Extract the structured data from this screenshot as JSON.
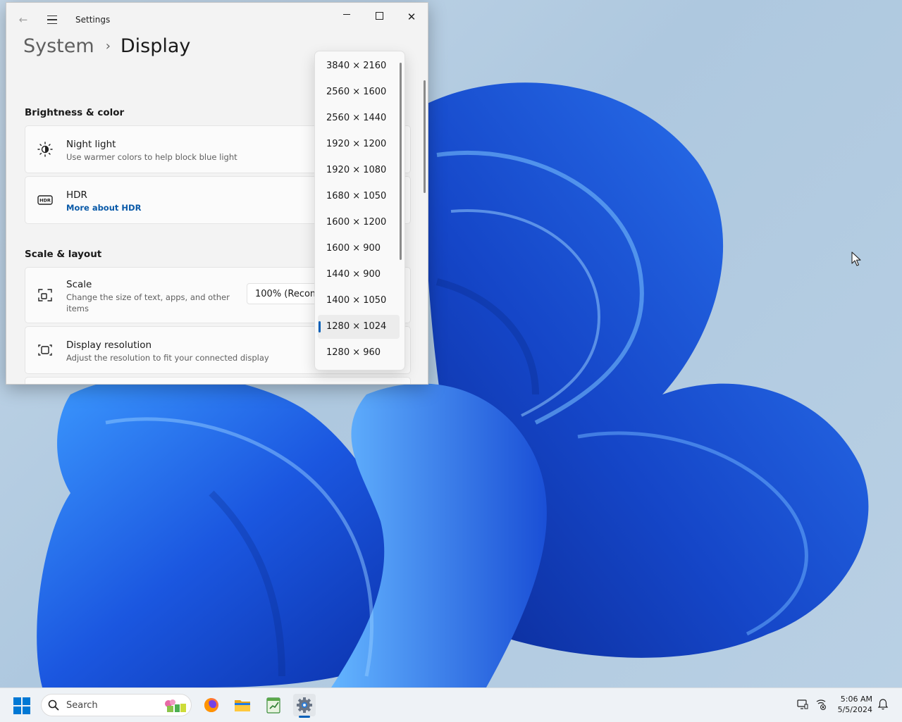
{
  "window": {
    "app_title": "Settings",
    "breadcrumb": {
      "parent": "System",
      "separator": "›",
      "current": "Display"
    }
  },
  "sections": {
    "brightness": {
      "header": "Brightness & color",
      "night_light": {
        "title": "Night light",
        "subtitle": "Use warmer colors to help block blue light",
        "icon": "sun-icon"
      },
      "hdr": {
        "title": "HDR",
        "link": "More about HDR",
        "icon": "hdr-icon"
      }
    },
    "scale_layout": {
      "header": "Scale & layout",
      "scale": {
        "title": "Scale",
        "subtitle_line1": "Change the size of text, apps, and other",
        "subtitle_line2": "items",
        "value": "100% (Recommended)",
        "icon": "scale-icon"
      },
      "resolution": {
        "title": "Display resolution",
        "subtitle": "Adjust the resolution to fit your connected display",
        "icon": "resolution-icon"
      }
    }
  },
  "resolution_dropdown": {
    "options": [
      "3840 × 2160",
      "2560 × 1600",
      "2560 × 1440",
      "1920 × 1200",
      "1920 × 1080",
      "1680 × 1050",
      "1600 × 1200",
      "1600 × 900",
      "1440 × 900",
      "1400 × 1050",
      "1280 × 1024",
      "1280 × 960"
    ],
    "selected": "1280 × 1024"
  },
  "taskbar": {
    "search_placeholder": "Search",
    "apps": [
      "firefox-icon",
      "file-explorer-icon",
      "notepad-icon",
      "settings-icon"
    ],
    "active_app": "settings-icon",
    "time": "5:06 AM",
    "date": "5/5/2024"
  },
  "colors": {
    "accent": "#005fb8",
    "link": "#0a5aa8",
    "window_bg": "#f3f3f3",
    "wallpaper_blue": "#1d5fe6"
  }
}
